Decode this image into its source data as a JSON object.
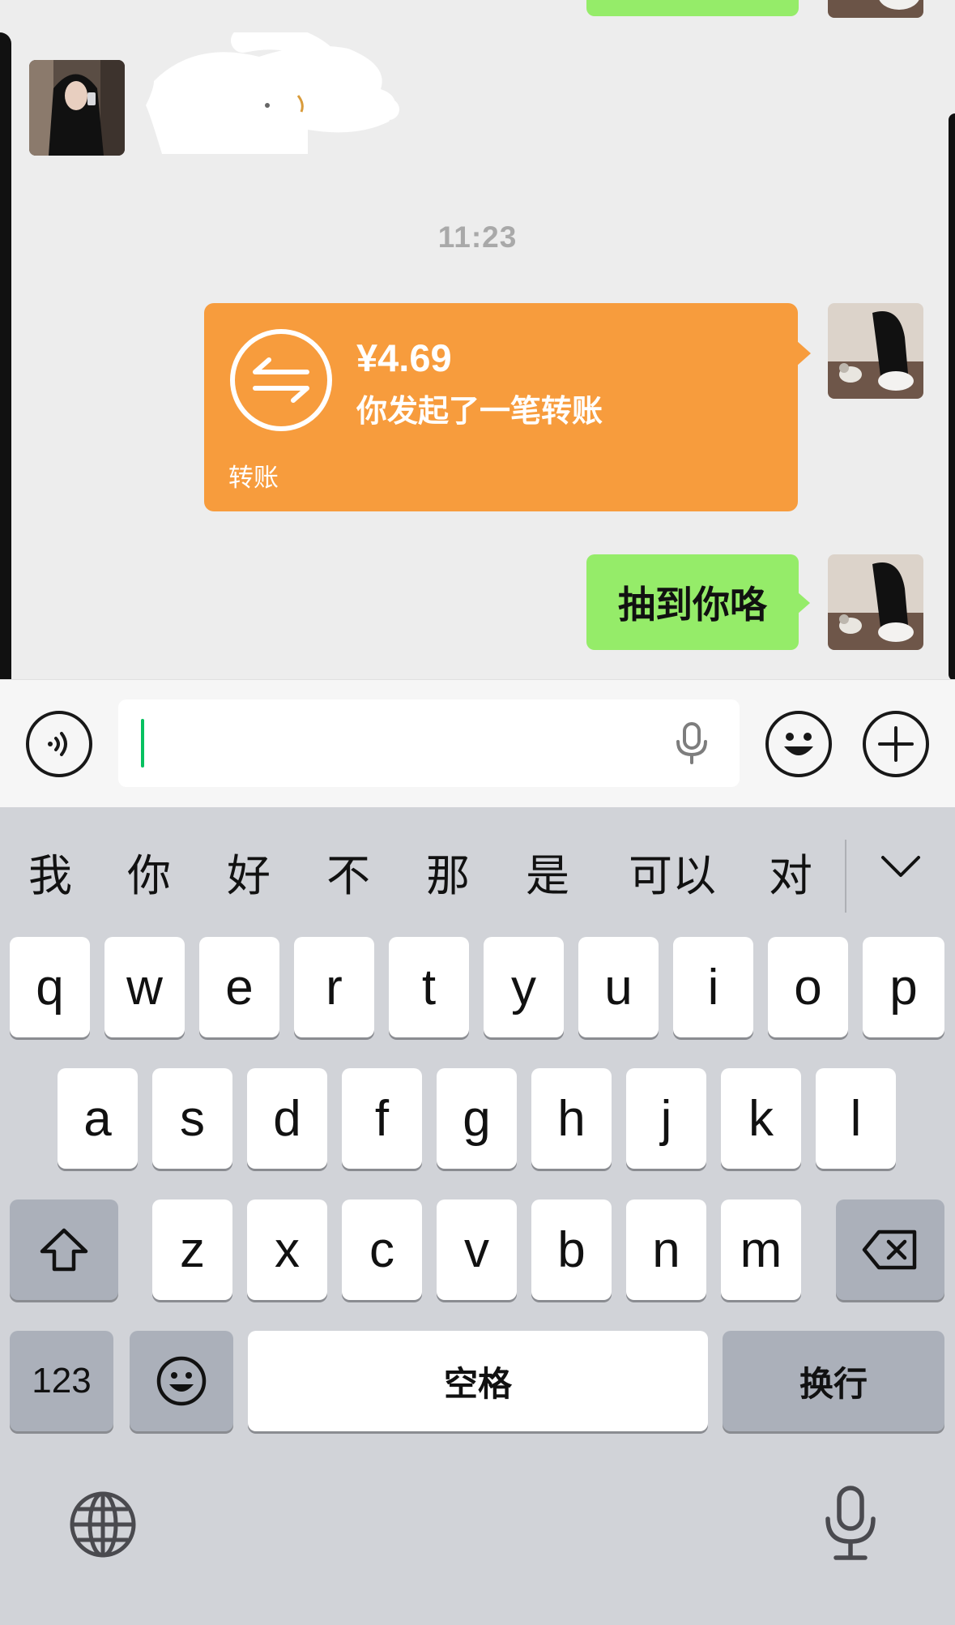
{
  "chat": {
    "messages": [
      {
        "type": "text",
        "side": "right",
        "text": ""
      },
      {
        "type": "text",
        "side": "left",
        "text": ""
      },
      {
        "type": "timestamp",
        "text": "11:23"
      },
      {
        "type": "transfer",
        "side": "right",
        "amount": "¥4.69",
        "description": "你发起了一笔转账",
        "label": "转账"
      },
      {
        "type": "text",
        "side": "right",
        "text": "抽到你咯"
      }
    ]
  },
  "input_bar": {
    "voice_icon": "voice-icon",
    "input_value": "",
    "mic_icon": "microphone-icon",
    "emoji_icon": "emoji-icon",
    "plus_icon": "plus-icon"
  },
  "keyboard": {
    "candidates": [
      "我",
      "你",
      "好",
      "不",
      "那",
      "是",
      "可以",
      "对"
    ],
    "rows": [
      [
        "q",
        "w",
        "e",
        "r",
        "t",
        "y",
        "u",
        "i",
        "o",
        "p"
      ],
      [
        "a",
        "s",
        "d",
        "f",
        "g",
        "h",
        "j",
        "k",
        "l"
      ],
      [
        "z",
        "x",
        "c",
        "v",
        "b",
        "n",
        "m"
      ]
    ],
    "numbers_label": "123",
    "space_label": "空格",
    "return_label": "换行",
    "shift_icon": "shift-icon",
    "delete_icon": "backspace-icon",
    "emoji_icon": "emoji-icon",
    "globe_icon": "globe-icon",
    "dictation_icon": "microphone-icon",
    "expand_icon": "chevron-down-icon"
  },
  "colors": {
    "chat_bg": "#ededed",
    "bubble_green": "#95ec69",
    "transfer_orange": "#f79c3d",
    "caret_green": "#07c160",
    "keyboard_bg": "#d1d3d8"
  }
}
